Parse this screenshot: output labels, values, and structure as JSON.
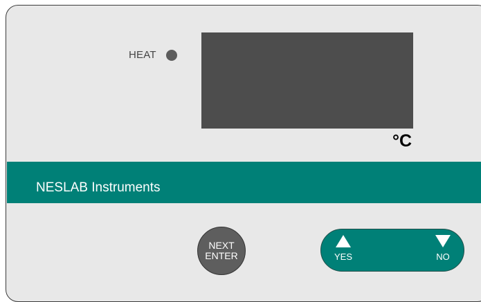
{
  "indicator": {
    "heat_label": "HEAT"
  },
  "display": {
    "unit": "°C"
  },
  "brand": {
    "name": "NESLAB Instruments"
  },
  "controls": {
    "next_line1": "NEXT",
    "next_line2": "ENTER",
    "yes_label": "YES",
    "no_label": "NO",
    "yes_icon": "up-triangle-icon",
    "no_icon": "down-triangle-icon"
  },
  "colors": {
    "panel": "#e8e8e8",
    "display": "#4d4d4d",
    "accent_teal": "#008077",
    "led": "#5c5c5c",
    "next_button": "#5e5e5e"
  }
}
